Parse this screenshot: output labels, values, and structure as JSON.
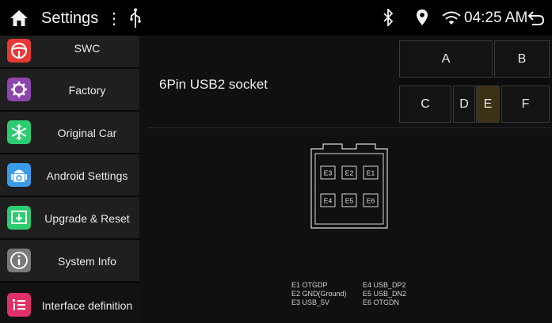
{
  "status_bar": {
    "title": "Settings",
    "menu_glyph": "⋮",
    "time": "04:25 AM",
    "icons": [
      "home-icon",
      "more-vert-icon",
      "usb-icon",
      "bluetooth-icon",
      "location-icon",
      "wifi-icon",
      "back-icon"
    ]
  },
  "sidebar": {
    "items": [
      {
        "label": "SWC",
        "icon": "steering-wheel-icon",
        "color": "#e53935"
      },
      {
        "label": "Factory",
        "icon": "factory-gear-icon",
        "color": "#8e44ad"
      },
      {
        "label": "Original Car",
        "icon": "snowflake-icon",
        "color": "#2ecc71"
      },
      {
        "label": "Android Settings",
        "icon": "android-icon",
        "color": "#3a9be8"
      },
      {
        "label": "Upgrade & Reset",
        "icon": "download-icon",
        "color": "#2ecc71"
      },
      {
        "label": "System Info",
        "icon": "info-icon",
        "color": "#7a7a7a"
      },
      {
        "label": "Interface definition",
        "icon": "list-icon",
        "color": "#e0306a"
      }
    ],
    "accent": "#d9a800"
  },
  "main": {
    "socket_title": "6Pin USB2 socket",
    "connector_grid": {
      "top_row": [
        "A",
        "B"
      ],
      "bottom_row": [
        "C",
        "D",
        "E",
        "F"
      ],
      "selected": "E"
    },
    "connector_pins": {
      "top": [
        "E3",
        "E2",
        "E1"
      ],
      "bottom": [
        "E4",
        "E5",
        "E6"
      ]
    },
    "pin_legend_left": [
      "E1 OTGDP",
      "E2 GND(Ground)",
      "E3 USB_5V"
    ],
    "pin_legend_right": [
      "E4 USB_DP2",
      "E5 USB_DN2",
      "E6 OTGDN"
    ]
  }
}
